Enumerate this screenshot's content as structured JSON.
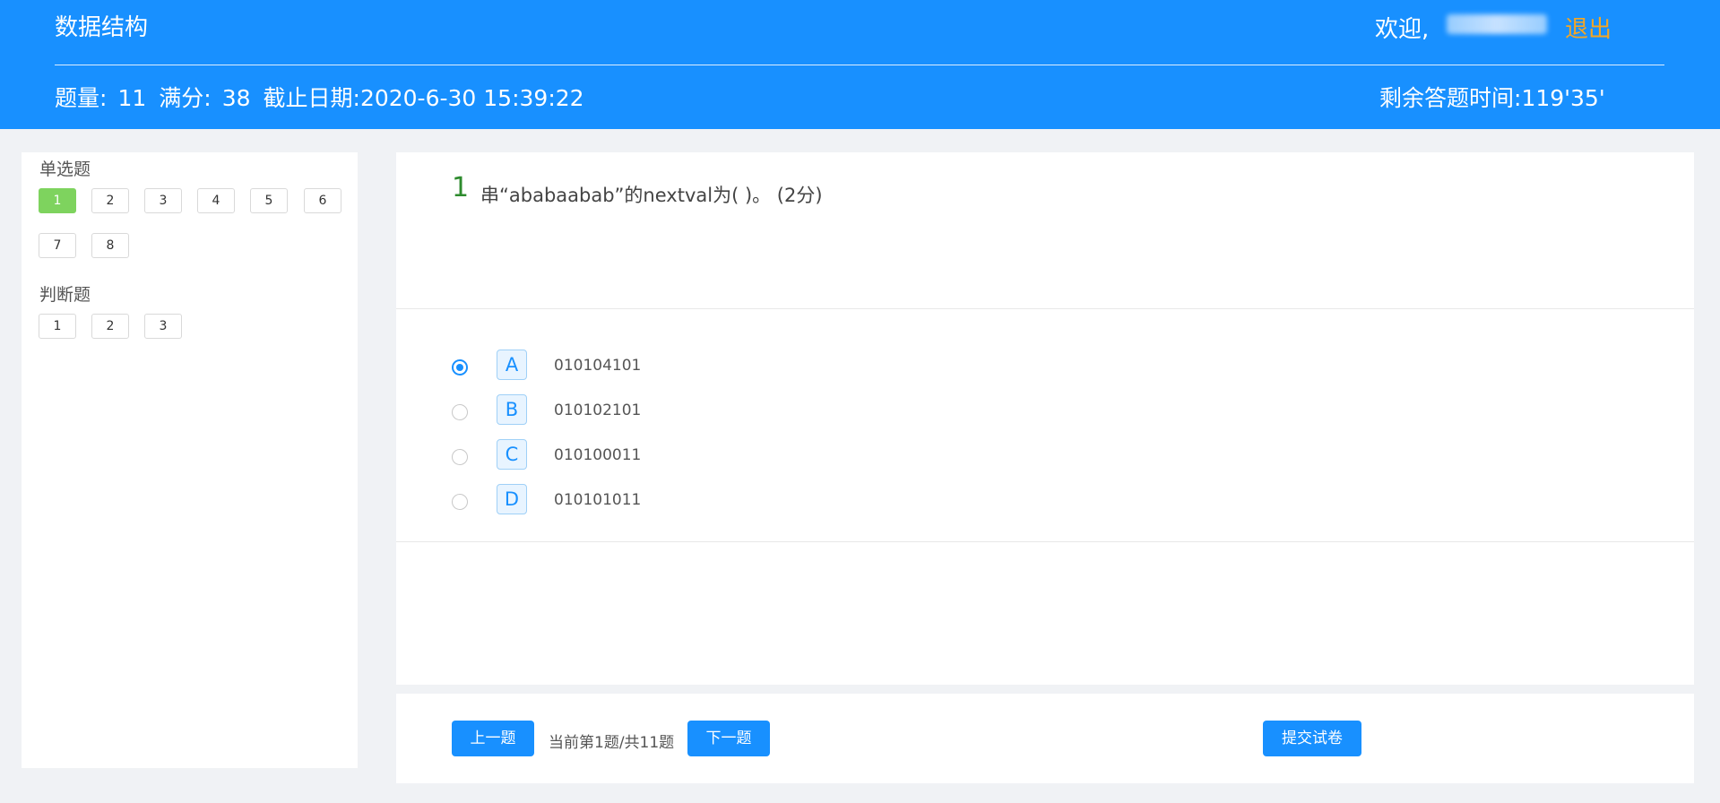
{
  "header": {
    "course_title": "数据结构",
    "welcome_label": "欢迎,",
    "logout_label": "退出",
    "question_count_label": "题量:",
    "question_count": "11",
    "full_score_label": "满分:",
    "full_score": "38",
    "deadline_label": "截止日期:",
    "deadline": "2020-6-30 15:39:22",
    "remaining_time_label": "剩余答题时间:",
    "remaining_time": "119'35'"
  },
  "sidebar": {
    "sections": [
      {
        "label": "单选题",
        "items": [
          "1",
          "2",
          "3",
          "4",
          "5",
          "6",
          "7",
          "8"
        ],
        "active_index": 0
      },
      {
        "label": "判断题",
        "items": [
          "1",
          "2",
          "3"
        ]
      }
    ]
  },
  "question": {
    "number": "1",
    "text": "串“ababaabab”的nextval为(   )。 (2分)",
    "selected_option": "A",
    "options": [
      {
        "letter": "A",
        "text": "010104101"
      },
      {
        "letter": "B",
        "text": "010102101"
      },
      {
        "letter": "C",
        "text": "010100011"
      },
      {
        "letter": "D",
        "text": "010101011"
      }
    ]
  },
  "footer": {
    "prev_label": "上一题",
    "page_info": "当前第1题/共11题",
    "next_label": "下一题",
    "submit_label": "提交试卷"
  },
  "colors": {
    "header_bg": "#1890ff",
    "logout": "#f5a623",
    "active_question": "#7ed35e",
    "question_number": "#2e8b2e"
  }
}
